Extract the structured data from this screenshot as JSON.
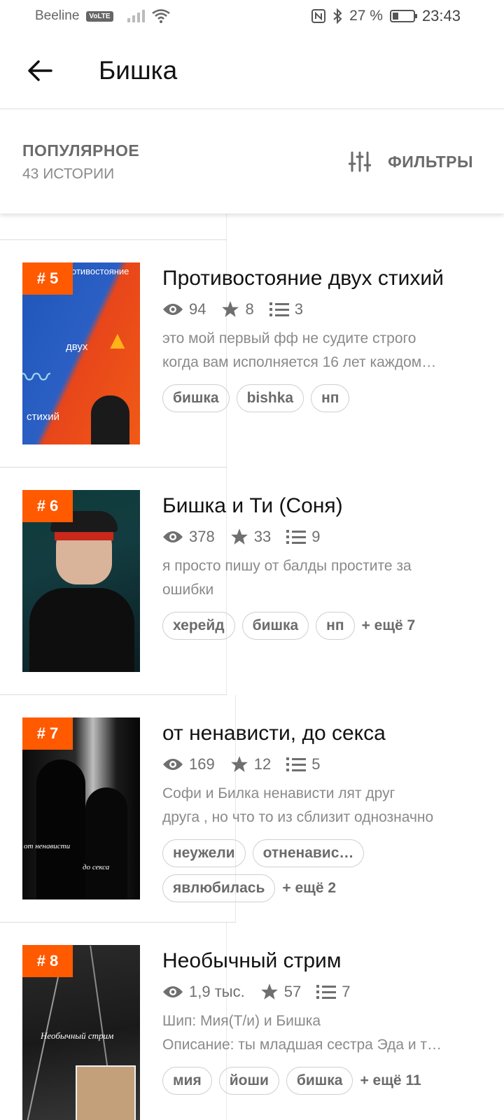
{
  "status_bar": {
    "carrier": "Beeline",
    "volte": "VoLTE",
    "battery": "27 %",
    "time": "23:43"
  },
  "app_bar": {
    "title": "Бишка"
  },
  "section": {
    "title": "ПОПУЛЯРНОЕ",
    "count": "43 ИСТОРИИ",
    "filters_label": "ФИЛЬТРЫ"
  },
  "stories": [
    {
      "rank": "# 5",
      "title": "Противостояние двух стихий",
      "views": "94",
      "votes": "8",
      "parts": "3",
      "desc": [
        "это мой первый фф не судите строго",
        "когда вам исполняется 16 лет каждом…"
      ],
      "tags": [
        "бишка",
        "bishka",
        "нп"
      ],
      "more": "",
      "cover_text": [
        "отивостояние",
        "двух",
        "стихий"
      ]
    },
    {
      "rank": "# 6",
      "title": "Бишка и Ти (Соня)",
      "views": "378",
      "votes": "33",
      "parts": "9",
      "desc": [
        "я просто пишу от балды простите за",
        "ошибки"
      ],
      "tags": [
        "херейд",
        "бишка",
        "нп"
      ],
      "more": "+ ещё 7",
      "cover_text": []
    },
    {
      "rank": "# 7",
      "title": "от ненависти, до секса",
      "views": "169",
      "votes": "12",
      "parts": "5",
      "desc": [
        "Софи и Билка ненависти лят друг",
        "друга , но что то из сблизит однозначно"
      ],
      "tags": [
        "неужели",
        "отненавис…",
        "явлюбилась"
      ],
      "more": "+ ещё 2",
      "cover_text": [
        "от ненависти",
        "до секса"
      ]
    },
    {
      "rank": "# 8",
      "title": "Необычный стрим",
      "views": "1,9 тыс.",
      "votes": "57",
      "parts": "7",
      "desc": [
        "Шип: Мия(Т/и) и Бишка",
        "Описание: ты младшая сестра Эда и т…"
      ],
      "tags": [
        "мия",
        "йоши",
        "бишка"
      ],
      "more": "+ ещё 11",
      "cover_text": [
        "Необычный стрим"
      ]
    }
  ]
}
